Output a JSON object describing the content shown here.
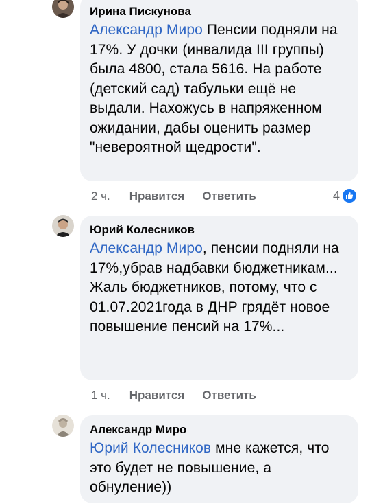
{
  "comments": [
    {
      "author": "Ирина Пискунова",
      "mention": "Александр Миро",
      "text": " Пенсии подняли на 17%.  У дочки (инвалида III группы) была 4800, стала 5616. На работе (детский сад) табульки ещё не выдали. Нахожусь в напряженном ожидании, дабы оценить размер \"невероятной щедрости\".",
      "time": "2 ч.",
      "like_label": "Нравится",
      "reply_label": "Ответить",
      "reaction_count": "4"
    },
    {
      "author": "Юрий Колесников",
      "mention": "Александр Миро",
      "text": ", пенсии подняли на 17%,убрав надбавки бюджетникам... Жаль бюджетников, потому, что с 01.07.2021года в ДНР грядёт новое повышение пенсий на 17%...",
      "time": "1 ч.",
      "like_label": "Нравится",
      "reply_label": "Ответить"
    },
    {
      "author": "Александр Миро",
      "mention": "Юрий Колесников",
      "text": " мне кажется, что это будет не повышение, а обнуление))"
    }
  ],
  "colors": {
    "bubble": "#f0f2f5",
    "mention": "#2f66c4",
    "meta": "#65676b",
    "like": "#1877f2"
  },
  "icons": [
    "avatar",
    "like-icon"
  ]
}
